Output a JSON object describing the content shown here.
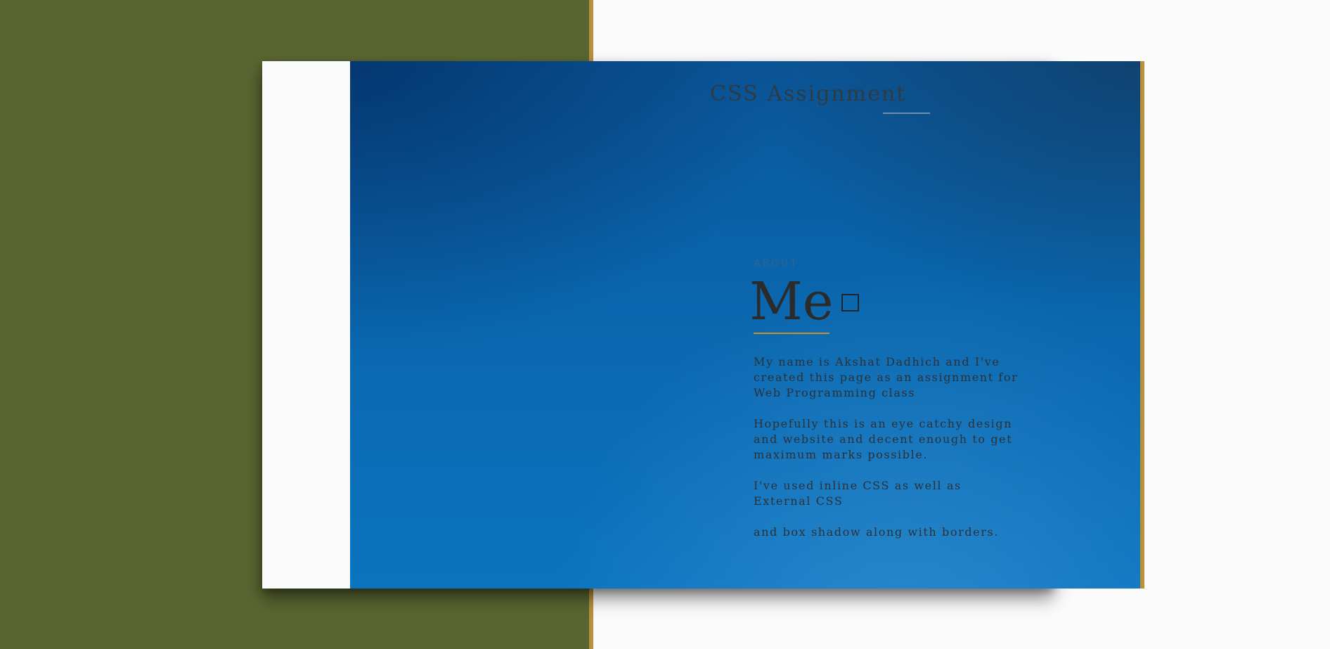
{
  "colors": {
    "left_panel": "#596631",
    "accent_gold": "#b8913e",
    "hero_blue": "#0a66ad",
    "page_bg": "#fbfbfb",
    "text_dark": "#2b2b2b"
  },
  "header": {
    "title": "CSS Assignment"
  },
  "about": {
    "eyebrow": "ABOUT",
    "heading": "Me",
    "paragraphs": [
      "My name is Akshat Dadhich and I've created this page as an assignment for Web Programming class",
      "Hopefully this is an eye catchy design and website and decent enough to get maximum marks possible.",
      "I've used inline CSS as well as External CSS",
      "and box shadow along with borders."
    ]
  }
}
